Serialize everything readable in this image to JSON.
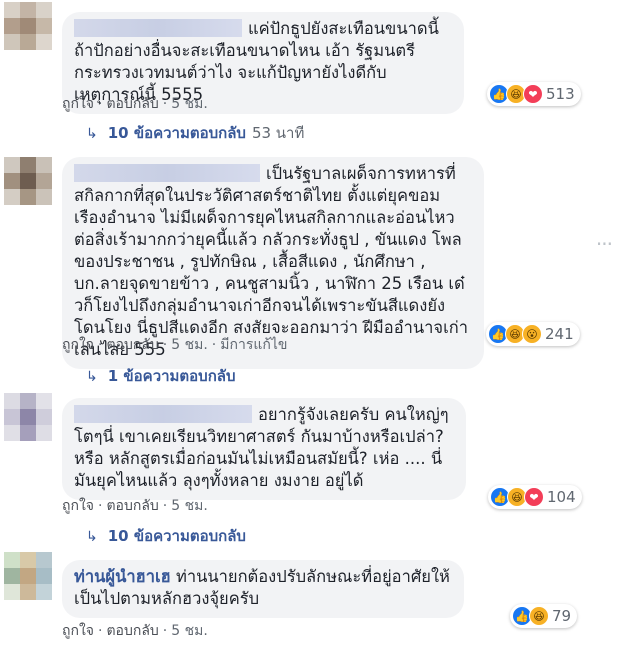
{
  "comments": [
    {
      "author": "",
      "text": "แค่ปักธูปยังสะเทือนขนาดนี้ ถ้าปักอย่างอื่นจะสะเทือนขนาดไหน เอ้า รัฐมนตรีกระทรวงเวทมนต์ว่าไง จะแก้ปัญหายังไงดีกับเหตุการณ์นี้ 5555",
      "like_label": "ถูกใจ",
      "reply_label": "ตอบกลับ",
      "time": "5 ชม.",
      "edited": "",
      "reaction_count": "513",
      "reactions": [
        "like-icon",
        "haha-icon",
        "love-icon"
      ],
      "replies_label": "10 ข้อความตอบกลับ",
      "replies_time": "53 นาที"
    },
    {
      "author": "",
      "text": "เป็นรัฐบาลเผด็จการทหารที่สกิลกากที่สุดในประวัติศาสตร์ชาติไทย ตั้งแต่ยุคขอมเรืองอำนาจ ไม่มีเผด็จการยุคไหนสกิลกากและอ่อนไหวต่อสิ่งเร้ามากกว่ายุคนี้แล้ว กลัวกระทั่งธูป , ขันแดง โพลของประชาชน , รูปทักษิณ , เสื้อสีแดง , นักศึกษา , บก.ลายจุดขายข้าว , คนชูสามนิ้ว , นาฬิกา 25 เรือน เด๋วก็โยงไปถึงกลุ่มอำนาจเก่าอีกจนได้เพราะขันสีแดงยังโดนโยง นี่ธูปสีแดงอีก สงสัยจะออกมาว่า ฝีมืออำนาจเก่าเล่นไสย 555",
      "like_label": "ถูกใจ",
      "reply_label": "ตอบกลับ",
      "time": "5 ชม.",
      "edited": "มีการแก้ไข",
      "reaction_count": "241",
      "reactions": [
        "like-icon",
        "haha-icon",
        "wow-icon"
      ],
      "replies_label": "1 ข้อความตอบกลับ",
      "replies_time": ""
    },
    {
      "author": "",
      "text": "อยากรู้จังเลยครับ คนใหญ่ๆโตๆนี่ เขาเคยเรียนวิทยาศาสตร์ กันมาบ้างหรือเปล่า? หรือ หลักสูตรเมื่อก่อนมันไม่เหมือนสมัยนี้? เห่อ .... นี่มันยุคไหนแล้ว ลุงๆทั้งหลาย งมงาย อยู่ได้",
      "like_label": "ถูกใจ",
      "reply_label": "ตอบกลับ",
      "time": "5 ชม.",
      "edited": "",
      "reaction_count": "104",
      "reactions": [
        "like-icon",
        "haha-icon",
        "love-icon"
      ],
      "replies_label": "10 ข้อความตอบกลับ",
      "replies_time": ""
    },
    {
      "author": "ท่านผู้นำฮาเฮ",
      "text": "ท่านนายกต้องปรับลักษณะที่อยู่อาศัยให้เป็นไปตามหลักฮวงจุ้ยครับ",
      "like_label": "ถูกใจ",
      "reply_label": "ตอบกลับ",
      "time": "5 ชม.",
      "edited": "",
      "reaction_count": "79",
      "reactions": [
        "like-icon",
        "haha-icon"
      ],
      "replies_label": "",
      "replies_time": ""
    }
  ],
  "colors": {
    "link": "#385898",
    "bubble": "#f2f3f5",
    "meta": "#606770"
  }
}
